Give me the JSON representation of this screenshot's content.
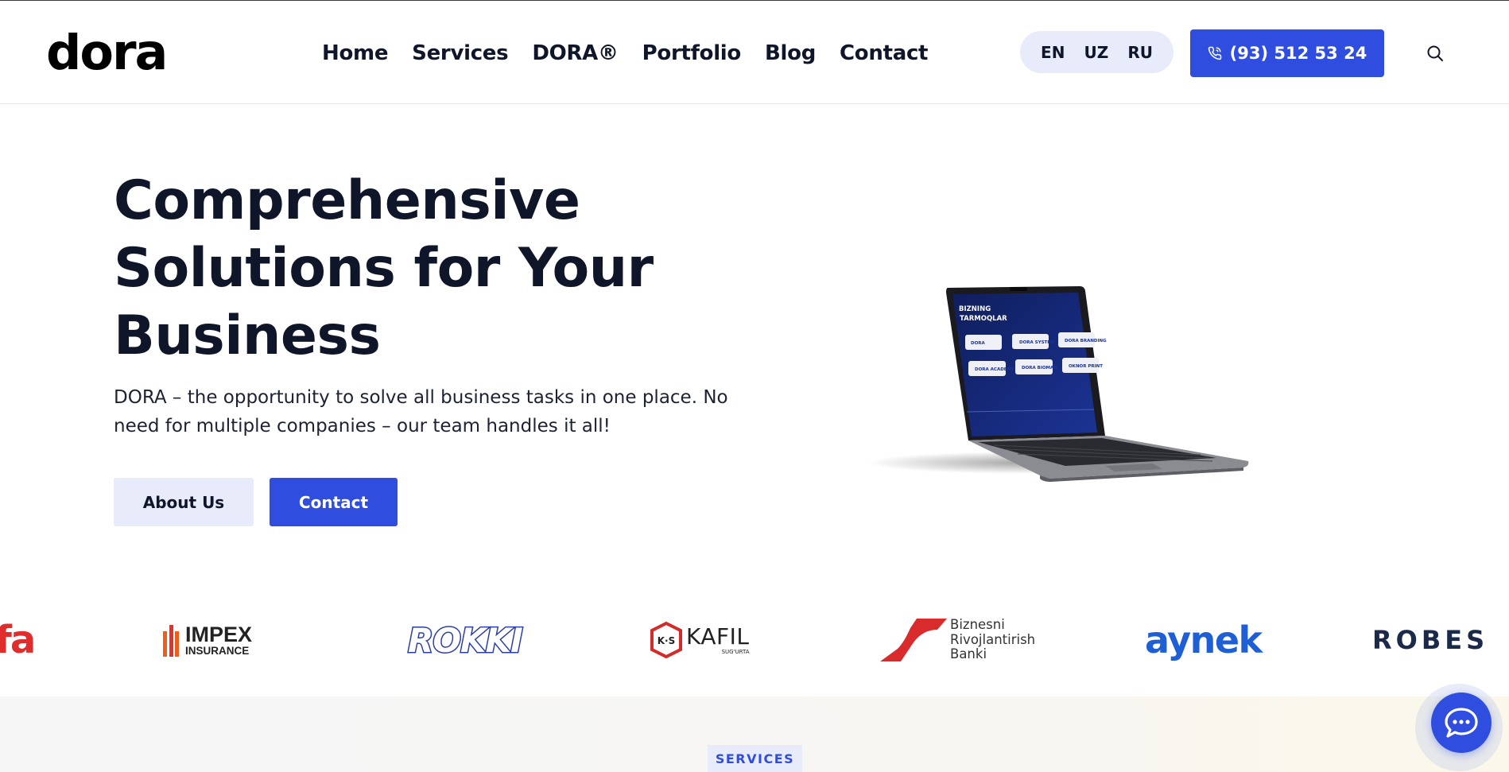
{
  "brand": {
    "logo_text": "dora",
    "accent": "#2f4ee0",
    "dark": "#101629"
  },
  "nav": {
    "items": [
      {
        "label": "Home"
      },
      {
        "label": "Services"
      },
      {
        "label": "DORA®"
      },
      {
        "label": "Portfolio"
      },
      {
        "label": "Blog"
      },
      {
        "label": "Contact"
      }
    ]
  },
  "languages": [
    "EN",
    "UZ",
    "RU"
  ],
  "header": {
    "phone": "(93) 512 53 24",
    "phone_icon": "phone-icon",
    "search_icon": "search-icon"
  },
  "hero": {
    "title_lines": [
      "Comprehensive",
      "Solutions for Your",
      "Business"
    ],
    "description_lines": [
      "DORA – the opportunity to solve all business tasks in one place. No",
      "need for multiple companies – our team handles it all!"
    ],
    "about_label": "About Us",
    "contact_label": "Contact"
  },
  "laptop_screen": {
    "heading_1": "BIZNING",
    "heading_2": "TARMOQLAR",
    "cards": [
      "DORA",
      "DORA SYSTEM",
      "DORA BRANDING",
      "DORA ACADEMY",
      "DORA BIOMAN",
      "OKNOR PRINT"
    ]
  },
  "partners": {
    "fa": "fa",
    "impex_1": "IMPEX",
    "impex_2": "INSURANCE",
    "rokki": "ROKKI",
    "kafil_mark": "K·S",
    "kafil": "KAFIL",
    "kafil_sub": "SUG'URTA",
    "bank_1": "Biznesni",
    "bank_2": "Rivojlantirish",
    "bank_3": "Banki",
    "aynek": "aynek",
    "robes": "ROBES"
  },
  "services_badge": "SERVICES",
  "chat_icon": "chat-bubble-icon"
}
